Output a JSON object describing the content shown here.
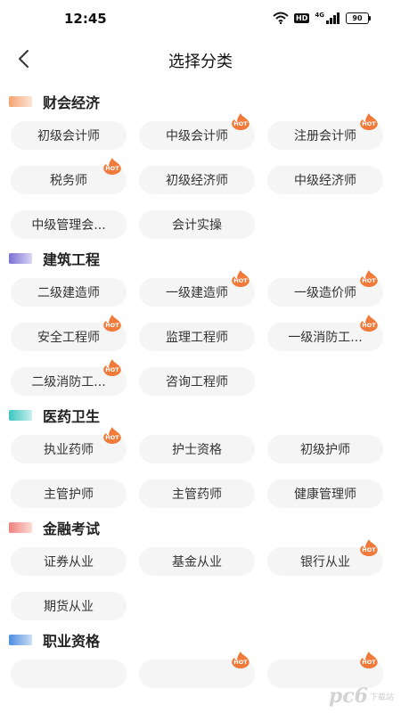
{
  "status_bar": {
    "time": "12:45",
    "hd_label": "HD",
    "network_label": "4G",
    "battery": "90"
  },
  "nav": {
    "title": "选择分类"
  },
  "hot_label": "HOT",
  "sections": [
    {
      "title": "财会经济",
      "icon_color": "#f5a36f",
      "items": [
        {
          "label": "初级会计师",
          "hot": false
        },
        {
          "label": "中级会计师",
          "hot": true
        },
        {
          "label": "注册会计师",
          "hot": true
        },
        {
          "label": "税务师",
          "hot": true
        },
        {
          "label": "初级经济师",
          "hot": false
        },
        {
          "label": "中级经济师",
          "hot": false
        },
        {
          "label": "中级管理会...",
          "hot": false
        },
        {
          "label": "会计实操",
          "hot": false
        }
      ]
    },
    {
      "title": "建筑工程",
      "icon_color": "#7b6fd6",
      "items": [
        {
          "label": "二级建造师",
          "hot": false
        },
        {
          "label": "一级建造师",
          "hot": true
        },
        {
          "label": "一级造价师",
          "hot": true
        },
        {
          "label": "安全工程师",
          "hot": true
        },
        {
          "label": "监理工程师",
          "hot": false
        },
        {
          "label": "一级消防工...",
          "hot": true
        },
        {
          "label": "二级消防工...",
          "hot": true
        },
        {
          "label": "咨询工程师",
          "hot": false
        }
      ]
    },
    {
      "title": "医药卫生",
      "icon_color": "#3cc6c0",
      "items": [
        {
          "label": "执业药师",
          "hot": true
        },
        {
          "label": "护士资格",
          "hot": false
        },
        {
          "label": "初级护师",
          "hot": false
        },
        {
          "label": "主管护师",
          "hot": false
        },
        {
          "label": "主管药师",
          "hot": false
        },
        {
          "label": "健康管理师",
          "hot": false
        }
      ]
    },
    {
      "title": "金融考试",
      "icon_color": "#f0817a",
      "items": [
        {
          "label": "证券从业",
          "hot": false
        },
        {
          "label": "基金从业",
          "hot": false
        },
        {
          "label": "银行从业",
          "hot": true
        },
        {
          "label": "期货从业",
          "hot": false
        }
      ]
    },
    {
      "title": "职业资格",
      "icon_color": "#4b8de0",
      "items": [
        {
          "label": "",
          "hot": false
        },
        {
          "label": "",
          "hot": true
        },
        {
          "label": "",
          "hot": true
        }
      ]
    }
  ],
  "colors": {
    "hot_badge": "#f07a3a",
    "chip_bg": "#f5f5f5"
  },
  "watermark": {
    "text": "pc6",
    "sub": "下载站"
  }
}
